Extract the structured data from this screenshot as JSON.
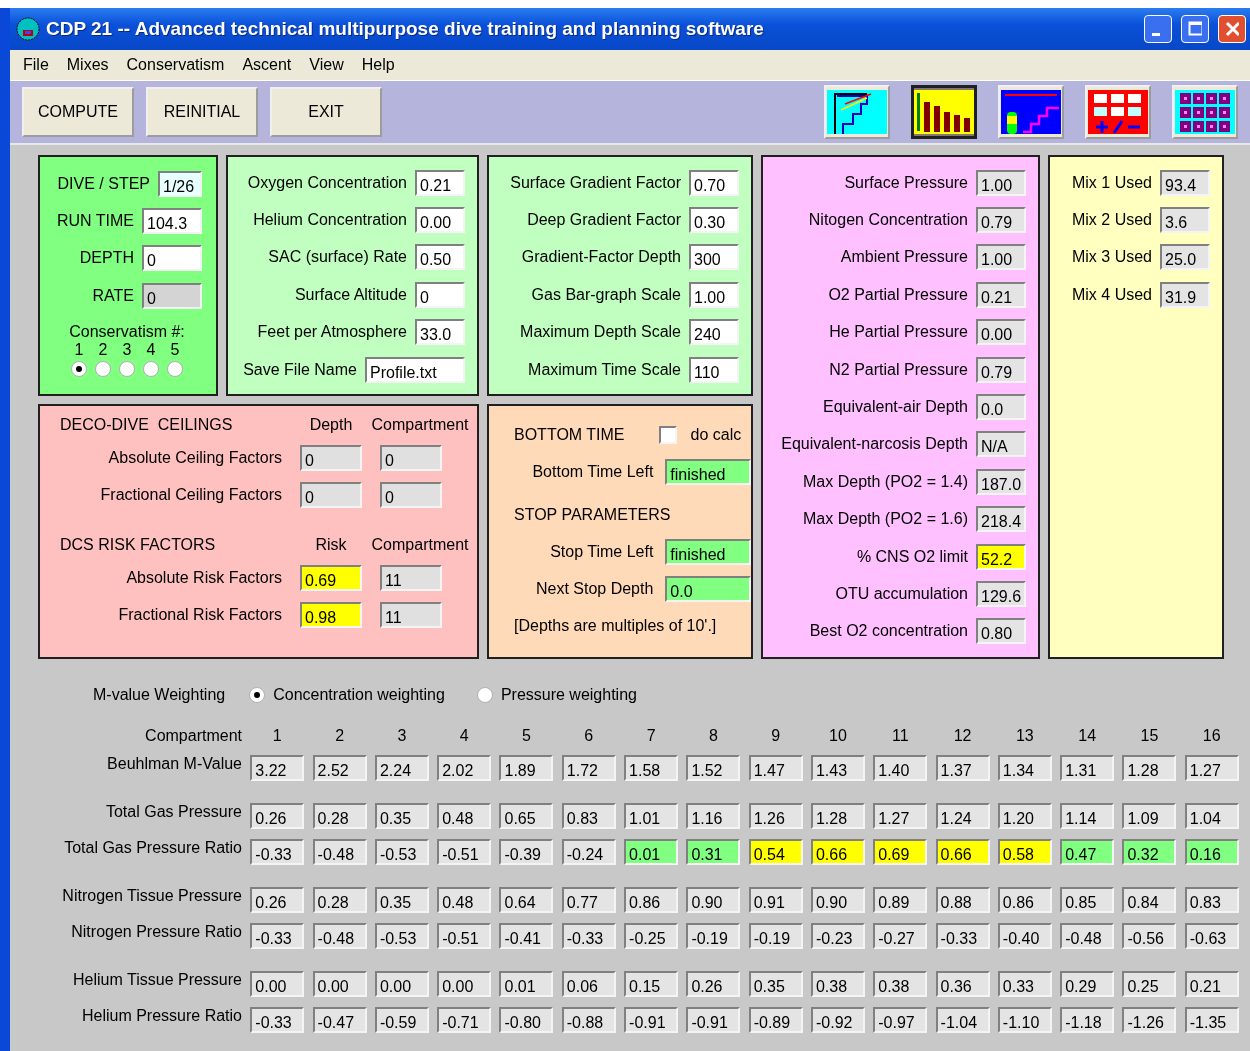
{
  "window": {
    "title": "CDP 21 -- Advanced technical multipurpose dive training and planning software"
  },
  "menu": [
    "File",
    "Mixes",
    "Conservatism",
    "Ascent",
    "View",
    "Help"
  ],
  "buttons": [
    "COMPUTE",
    "REINITIAL",
    "EXIT"
  ],
  "toolbar_icons": [
    {
      "kind": "profile",
      "selected": false
    },
    {
      "kind": "bars",
      "selected": true
    },
    {
      "kind": "deco",
      "selected": false
    },
    {
      "kind": "calculator",
      "selected": false
    },
    {
      "kind": "grid",
      "selected": false
    }
  ],
  "dive_panel": {
    "fields": [
      {
        "label": "DIVE / STEP",
        "value": "1/26",
        "color": "#e8ffff"
      },
      {
        "label": "RUN TIME",
        "value": "104.3",
        "color": "#ffffff"
      },
      {
        "label": "DEPTH",
        "value": "0",
        "color": "#ffffff"
      },
      {
        "label": "RATE",
        "value": "0",
        "color": "#d4d4d4"
      }
    ],
    "conservatism": {
      "label": "Conservatism #:",
      "options": [
        {
          "label": "1",
          "selected": true
        },
        {
          "label": "2",
          "selected": false
        },
        {
          "label": "3",
          "selected": false
        },
        {
          "label": "4",
          "selected": false
        },
        {
          "label": "5",
          "selected": false
        }
      ]
    }
  },
  "gas_panel": {
    "fields": [
      {
        "label": "Oxygen Concentration",
        "value": "0.21",
        "color": "#ffffff"
      },
      {
        "label": "Helium Concentration",
        "value": "0.00",
        "color": "#ffffff"
      },
      {
        "label": "SAC (surface) Rate",
        "value": "0.50",
        "color": "#ffffff"
      },
      {
        "label": "Surface Altitude",
        "value": "0",
        "color": "#ffffff"
      },
      {
        "label": "Feet per Atmosphere",
        "value": "33.0",
        "color": "#ffffff"
      },
      {
        "label": "Save File Name",
        "value": "Profile.txt",
        "color": "#ffffff"
      }
    ]
  },
  "gradient_panel": {
    "fields": [
      {
        "label": "Surface Gradient Factor",
        "value": "0.70",
        "color": "#ffffff"
      },
      {
        "label": "Deep Gradient Factor",
        "value": "0.30",
        "color": "#ffffff"
      },
      {
        "label": "Gradient-Factor Depth",
        "value": "300",
        "color": "#ffffff"
      },
      {
        "label": "Gas Bar-graph Scale",
        "value": "1.00",
        "color": "#ffffff"
      },
      {
        "label": "Maximum Depth Scale",
        "value": "240",
        "color": "#ffffff"
      },
      {
        "label": "Maximum Time Scale",
        "value": "110",
        "color": "#ffffff"
      }
    ]
  },
  "pressure_panel": {
    "fields": [
      {
        "label": "Surface Pressure",
        "value": "1.00",
        "color": "#e4e4e4"
      },
      {
        "label": "Nitogen Concentration",
        "value": "0.79",
        "color": "#e4e4e4"
      },
      {
        "label": "Ambient Pressure",
        "value": "1.00",
        "color": "#e4e4e4"
      },
      {
        "label": "O2 Partial Pressure",
        "value": "0.21",
        "color": "#e4e4e4"
      },
      {
        "label": "He Partial Pressure",
        "value": "0.00",
        "color": "#e4e4e4"
      },
      {
        "label": "N2 Partial Pressure",
        "value": "0.79",
        "color": "#e4e4e4"
      },
      {
        "label": "Equivalent-air Depth",
        "value": "0.0",
        "color": "#e4e4e4"
      },
      {
        "label": "Equivalent-narcosis Depth",
        "value": "N/A",
        "color": "#e4e4e4"
      },
      {
        "label": "Max Depth (PO2 = 1.4)",
        "value": "187.0",
        "color": "#e4e4e4"
      },
      {
        "label": "Max Depth (PO2 = 1.6)",
        "value": "218.4",
        "color": "#e4e4e4"
      },
      {
        "label": "% CNS O2 limit",
        "value": "52.2",
        "color": "#ffff00"
      },
      {
        "label": "OTU accumulation",
        "value": "129.6",
        "color": "#e4e4e4"
      },
      {
        "label": "Best O2 concentration",
        "value": "0.80",
        "color": "#e4e4e4"
      }
    ]
  },
  "mix_panel": {
    "fields": [
      {
        "label": "Mix 1 Used",
        "value": "93.4",
        "color": "#e4e4e4"
      },
      {
        "label": "Mix 2 Used",
        "value": "3.6",
        "color": "#e4e4e4"
      },
      {
        "label": "Mix 3 Used",
        "value": "25.0",
        "color": "#e4e4e4"
      },
      {
        "label": "Mix 4 Used",
        "value": "31.9",
        "color": "#e4e4e4"
      }
    ]
  },
  "ceilings_panel": {
    "sections": [
      {
        "title": "DECO-DIVE  CEILINGS",
        "columns": [
          "Depth",
          "Compartment"
        ],
        "rows": [
          {
            "label": "Absolute Ceiling Factors",
            "cells": [
              {
                "value": "0",
                "color": "#e0e0e0"
              },
              {
                "value": "0",
                "color": "#e0e0e0"
              }
            ]
          },
          {
            "label": "Fractional Ceiling Factors",
            "cells": [
              {
                "value": "0",
                "color": "#e0e0e0"
              },
              {
                "value": "0",
                "color": "#e0e0e0"
              }
            ]
          }
        ]
      },
      {
        "title": "DCS RISK FACTORS",
        "columns": [
          "Risk",
          "Compartment"
        ],
        "rows": [
          {
            "label": "Absolute Risk Factors",
            "cells": [
              {
                "value": "0.69",
                "color": "#ffff00"
              },
              {
                "value": "11",
                "color": "#e0e0e0"
              }
            ]
          },
          {
            "label": "Fractional Risk Factors",
            "cells": [
              {
                "value": "0.98",
                "color": "#ffff00"
              },
              {
                "value": "11",
                "color": "#e0e0e0"
              }
            ]
          }
        ]
      }
    ]
  },
  "time_panel": {
    "bottom_title": "BOTTOM TIME",
    "do_calc": {
      "label": "do calc",
      "checked": false
    },
    "bottom_fields": [
      {
        "label": "Bottom Time Left",
        "value": "finished",
        "color": "#80ff80"
      }
    ],
    "stop_title": "STOP PARAMETERS",
    "stop_fields": [
      {
        "label": "Stop Time Left",
        "value": "finished",
        "color": "#80ff80"
      },
      {
        "label": "Next Stop Depth",
        "value": "0.0",
        "color": "#80ff80"
      }
    ],
    "note": "[Depths are multiples of 10'.]"
  },
  "weighting": {
    "label": "M-value Weighting",
    "options": [
      {
        "label": "Concentration weighting",
        "selected": true
      },
      {
        "label": "Pressure weighting",
        "selected": false
      }
    ]
  },
  "compartments": {
    "label": "Compartment",
    "columns": [
      "1",
      "2",
      "3",
      "4",
      "5",
      "6",
      "7",
      "8",
      "9",
      "10",
      "11",
      "12",
      "13",
      "14",
      "15",
      "16"
    ],
    "groups": [
      {
        "rows": [
          {
            "label": "Beuhlman M-Value",
            "cells": [
              {
                "value": "3.22",
                "color": "#e4e4e4"
              },
              {
                "value": "2.52",
                "color": "#e4e4e4"
              },
              {
                "value": "2.24",
                "color": "#e4e4e4"
              },
              {
                "value": "2.02",
                "color": "#e4e4e4"
              },
              {
                "value": "1.89",
                "color": "#e4e4e4"
              },
              {
                "value": "1.72",
                "color": "#e4e4e4"
              },
              {
                "value": "1.58",
                "color": "#e4e4e4"
              },
              {
                "value": "1.52",
                "color": "#e4e4e4"
              },
              {
                "value": "1.47",
                "color": "#e4e4e4"
              },
              {
                "value": "1.43",
                "color": "#e4e4e4"
              },
              {
                "value": "1.40",
                "color": "#e4e4e4"
              },
              {
                "value": "1.37",
                "color": "#e4e4e4"
              },
              {
                "value": "1.34",
                "color": "#e4e4e4"
              },
              {
                "value": "1.31",
                "color": "#e4e4e4"
              },
              {
                "value": "1.28",
                "color": "#e4e4e4"
              },
              {
                "value": "1.27",
                "color": "#e4e4e4"
              }
            ]
          }
        ]
      },
      {
        "rows": [
          {
            "label": "Total Gas Pressure",
            "cells": [
              {
                "value": "0.26",
                "color": "#e4e4e4"
              },
              {
                "value": "0.28",
                "color": "#e4e4e4"
              },
              {
                "value": "0.35",
                "color": "#e4e4e4"
              },
              {
                "value": "0.48",
                "color": "#e4e4e4"
              },
              {
                "value": "0.65",
                "color": "#e4e4e4"
              },
              {
                "value": "0.83",
                "color": "#e4e4e4"
              },
              {
                "value": "1.01",
                "color": "#e4e4e4"
              },
              {
                "value": "1.16",
                "color": "#e4e4e4"
              },
              {
                "value": "1.26",
                "color": "#e4e4e4"
              },
              {
                "value": "1.28",
                "color": "#e4e4e4"
              },
              {
                "value": "1.27",
                "color": "#e4e4e4"
              },
              {
                "value": "1.24",
                "color": "#e4e4e4"
              },
              {
                "value": "1.20",
                "color": "#e4e4e4"
              },
              {
                "value": "1.14",
                "color": "#e4e4e4"
              },
              {
                "value": "1.09",
                "color": "#e4e4e4"
              },
              {
                "value": "1.04",
                "color": "#e4e4e4"
              }
            ]
          },
          {
            "label": "Total Gas Pressure Ratio",
            "cells": [
              {
                "value": "-0.33",
                "color": "#e4e4e4"
              },
              {
                "value": "-0.48",
                "color": "#e4e4e4"
              },
              {
                "value": "-0.53",
                "color": "#e4e4e4"
              },
              {
                "value": "-0.51",
                "color": "#e4e4e4"
              },
              {
                "value": "-0.39",
                "color": "#e4e4e4"
              },
              {
                "value": "-0.24",
                "color": "#e4e4e4"
              },
              {
                "value": "0.01",
                "color": "#80ff80"
              },
              {
                "value": "0.31",
                "color": "#80ff80"
              },
              {
                "value": "0.54",
                "color": "#ffff00"
              },
              {
                "value": "0.66",
                "color": "#ffff00"
              },
              {
                "value": "0.69",
                "color": "#ffff00"
              },
              {
                "value": "0.66",
                "color": "#ffff00"
              },
              {
                "value": "0.58",
                "color": "#ffff00"
              },
              {
                "value": "0.47",
                "color": "#80ff80"
              },
              {
                "value": "0.32",
                "color": "#80ff80"
              },
              {
                "value": "0.16",
                "color": "#80ff80"
              }
            ]
          }
        ]
      },
      {
        "rows": [
          {
            "label": "Nitrogen Tissue Pressure",
            "cells": [
              {
                "value": "0.26",
                "color": "#e4e4e4"
              },
              {
                "value": "0.28",
                "color": "#e4e4e4"
              },
              {
                "value": "0.35",
                "color": "#e4e4e4"
              },
              {
                "value": "0.48",
                "color": "#e4e4e4"
              },
              {
                "value": "0.64",
                "color": "#e4e4e4"
              },
              {
                "value": "0.77",
                "color": "#e4e4e4"
              },
              {
                "value": "0.86",
                "color": "#e4e4e4"
              },
              {
                "value": "0.90",
                "color": "#e4e4e4"
              },
              {
                "value": "0.91",
                "color": "#e4e4e4"
              },
              {
                "value": "0.90",
                "color": "#e4e4e4"
              },
              {
                "value": "0.89",
                "color": "#e4e4e4"
              },
              {
                "value": "0.88",
                "color": "#e4e4e4"
              },
              {
                "value": "0.86",
                "color": "#e4e4e4"
              },
              {
                "value": "0.85",
                "color": "#e4e4e4"
              },
              {
                "value": "0.84",
                "color": "#e4e4e4"
              },
              {
                "value": "0.83",
                "color": "#e4e4e4"
              }
            ]
          },
          {
            "label": "Nitrogen Pressure Ratio",
            "cells": [
              {
                "value": "-0.33",
                "color": "#e4e4e4"
              },
              {
                "value": "-0.48",
                "color": "#e4e4e4"
              },
              {
                "value": "-0.53",
                "color": "#e4e4e4"
              },
              {
                "value": "-0.51",
                "color": "#e4e4e4"
              },
              {
                "value": "-0.41",
                "color": "#e4e4e4"
              },
              {
                "value": "-0.33",
                "color": "#e4e4e4"
              },
              {
                "value": "-0.25",
                "color": "#e4e4e4"
              },
              {
                "value": "-0.19",
                "color": "#e4e4e4"
              },
              {
                "value": "-0.19",
                "color": "#e4e4e4"
              },
              {
                "value": "-0.23",
                "color": "#e4e4e4"
              },
              {
                "value": "-0.27",
                "color": "#e4e4e4"
              },
              {
                "value": "-0.33",
                "color": "#e4e4e4"
              },
              {
                "value": "-0.40",
                "color": "#e4e4e4"
              },
              {
                "value": "-0.48",
                "color": "#e4e4e4"
              },
              {
                "value": "-0.56",
                "color": "#e4e4e4"
              },
              {
                "value": "-0.63",
                "color": "#e4e4e4"
              }
            ]
          }
        ]
      },
      {
        "rows": [
          {
            "label": "Helium Tissue Pressure",
            "cells": [
              {
                "value": "0.00",
                "color": "#e4e4e4"
              },
              {
                "value": "0.00",
                "color": "#e4e4e4"
              },
              {
                "value": "0.00",
                "color": "#e4e4e4"
              },
              {
                "value": "0.00",
                "color": "#e4e4e4"
              },
              {
                "value": "0.01",
                "color": "#e4e4e4"
              },
              {
                "value": "0.06",
                "color": "#e4e4e4"
              },
              {
                "value": "0.15",
                "color": "#e4e4e4"
              },
              {
                "value": "0.26",
                "color": "#e4e4e4"
              },
              {
                "value": "0.35",
                "color": "#e4e4e4"
              },
              {
                "value": "0.38",
                "color": "#e4e4e4"
              },
              {
                "value": "0.38",
                "color": "#e4e4e4"
              },
              {
                "value": "0.36",
                "color": "#e4e4e4"
              },
              {
                "value": "0.33",
                "color": "#e4e4e4"
              },
              {
                "value": "0.29",
                "color": "#e4e4e4"
              },
              {
                "value": "0.25",
                "color": "#e4e4e4"
              },
              {
                "value": "0.21",
                "color": "#e4e4e4"
              }
            ]
          },
          {
            "label": "Helium Pressure Ratio",
            "cells": [
              {
                "value": "-0.33",
                "color": "#e4e4e4"
              },
              {
                "value": "-0.47",
                "color": "#e4e4e4"
              },
              {
                "value": "-0.59",
                "color": "#e4e4e4"
              },
              {
                "value": "-0.71",
                "color": "#e4e4e4"
              },
              {
                "value": "-0.80",
                "color": "#e4e4e4"
              },
              {
                "value": "-0.88",
                "color": "#e4e4e4"
              },
              {
                "value": "-0.91",
                "color": "#e4e4e4"
              },
              {
                "value": "-0.91",
                "color": "#e4e4e4"
              },
              {
                "value": "-0.89",
                "color": "#e4e4e4"
              },
              {
                "value": "-0.92",
                "color": "#e4e4e4"
              },
              {
                "value": "-0.97",
                "color": "#e4e4e4"
              },
              {
                "value": "-1.04",
                "color": "#e4e4e4"
              },
              {
                "value": "-1.10",
                "color": "#e4e4e4"
              },
              {
                "value": "-1.18",
                "color": "#e4e4e4"
              },
              {
                "value": "-1.26",
                "color": "#e4e4e4"
              },
              {
                "value": "-1.35",
                "color": "#e4e4e4"
              }
            ]
          }
        ]
      }
    ]
  }
}
